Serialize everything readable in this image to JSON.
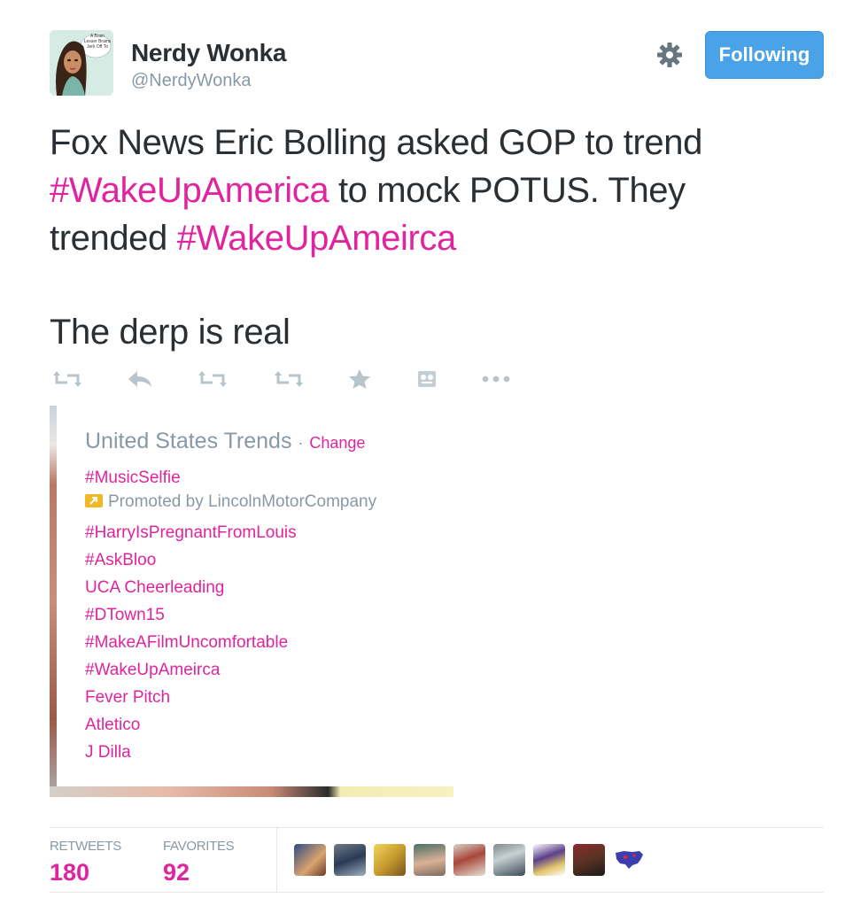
{
  "user": {
    "name": "Nerdy Wonka",
    "handle": "@NerdyWonka",
    "avatar_caption": "A Brain Lesser Brains Jerk Off To",
    "follow_label": "Following"
  },
  "tweet": {
    "line1": "Fox News Eric Bolling asked GOP to trend",
    "hashtag1": "#WakeUpAmerica",
    "line2_rest": " to mock POTUS. They",
    "line3_start": "trended ",
    "hashtag2": "#WakeUpAmeirca",
    "line4": "The derp is real"
  },
  "actions": [
    {
      "name": "retweet-icon"
    },
    {
      "name": "reply-icon"
    },
    {
      "name": "retweet-icon"
    },
    {
      "name": "retweet-icon"
    },
    {
      "name": "favorite-star-icon"
    },
    {
      "name": "storify-icon"
    },
    {
      "name": "more-icon"
    }
  ],
  "trends": {
    "title": "United States Trends",
    "separator": "·",
    "change_label": "Change",
    "items": [
      "#MusicSelfie",
      "#HarryIsPregnantFromLouis",
      "#AskBloo",
      "UCA Cheerleading",
      "#DTown15",
      "#MakeAFilmUncomfortable",
      "#WakeUpAmeirca",
      "Fever Pitch",
      "Atletico",
      "J Dilla"
    ],
    "promoted": "Promoted by LincolnMotorCompany"
  },
  "stats": {
    "retweets_label": "RETWEETS",
    "retweets_value": "180",
    "favorites_label": "FAVORITES",
    "favorites_value": "92"
  },
  "colors": {
    "link": "#e0249e",
    "muted": "#8899a6",
    "follow_button": "#4aa3e8",
    "text": "#292f33"
  }
}
